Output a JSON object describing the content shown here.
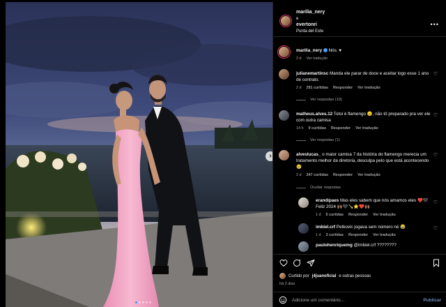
{
  "post": {
    "author": "marilia_nery",
    "conjunction": "e",
    "coauthor": "evertonri",
    "location": "Punta del Este",
    "more_icon": "more-horizontal-icon",
    "next_icon": "chevron-right-icon",
    "carousel": {
      "count": 5,
      "active": 1
    }
  },
  "caption": {
    "user": "marilia_nery",
    "text": "Nós. ♥",
    "time": "2 d",
    "translate": "Ver tradução"
  },
  "comments": [
    {
      "user": "julianemartinsc",
      "text": "Manda ele parar de doce e aceitar logo esse 1 ano de contrato.",
      "time": "2 d",
      "likes": "291 curtidas",
      "reply": "Responder",
      "translate": "Ver tradução",
      "replies_label": "Ver respostas (19)"
    },
    {
      "user": "matheus.alves.12",
      "text": "Totoi é flamengo 😑, não tô preparado pra ver ele com outra camisa",
      "time": "14 h",
      "likes": "9 curtidas",
      "reply": "Responder",
      "translate": "Ver tradução",
      "replies_label": "Ver respostas (1)"
    },
    {
      "user": "alveslucas_",
      "text": "o maior camisa 7 da história do flamengo merecia um tratamento melhor da diretoria, desculpa pelo que está acontecendo 😢",
      "time": "2 d",
      "likes": "247 curtidas",
      "reply": "Responder",
      "translate": "Ver tradução",
      "replies_label": "Ocultar respostas"
    }
  ],
  "replies": [
    {
      "user": "erandipaes",
      "text": "Mas eles sabem que nós amamos eles ❤️🖤 Feliz 2024 🙌🏽🖤🍾⭐❤️🙌🏽",
      "time": "1 d",
      "likes": "5 curtidas",
      "reply": "Responder",
      "translate": "Ver tradução"
    },
    {
      "user": "imbiel.crf",
      "text": "Petkovic jogava sem número né 😂",
      "time": "1 d",
      "likes": "3 curtidas",
      "reply": "Responder",
      "translate": "Ver tradução"
    },
    {
      "user": "paulohenriquemg",
      "text": "@imbiel.crf ????????",
      "time": "",
      "likes": "",
      "reply": "",
      "translate": ""
    }
  ],
  "actions": {
    "like_icon": "heart-icon",
    "comment_icon": "comment-icon",
    "share_icon": "send-icon",
    "save_icon": "bookmark-icon",
    "liked_prefix": "Curtido por",
    "liked_user": "j4juanoficial",
    "liked_suffix": "e outras pessoas",
    "time": "há 2 dias"
  },
  "composer": {
    "emoji_icon": "smiley-icon",
    "placeholder": "Adicione um comentário...",
    "publish": "Publicar"
  },
  "colors": {
    "background": "#000000",
    "text": "#f5f5f5",
    "muted": "#a8a8a8",
    "verified": "#3897f0",
    "publish": "#6e8fbf",
    "dress": "#f4a7c8"
  }
}
